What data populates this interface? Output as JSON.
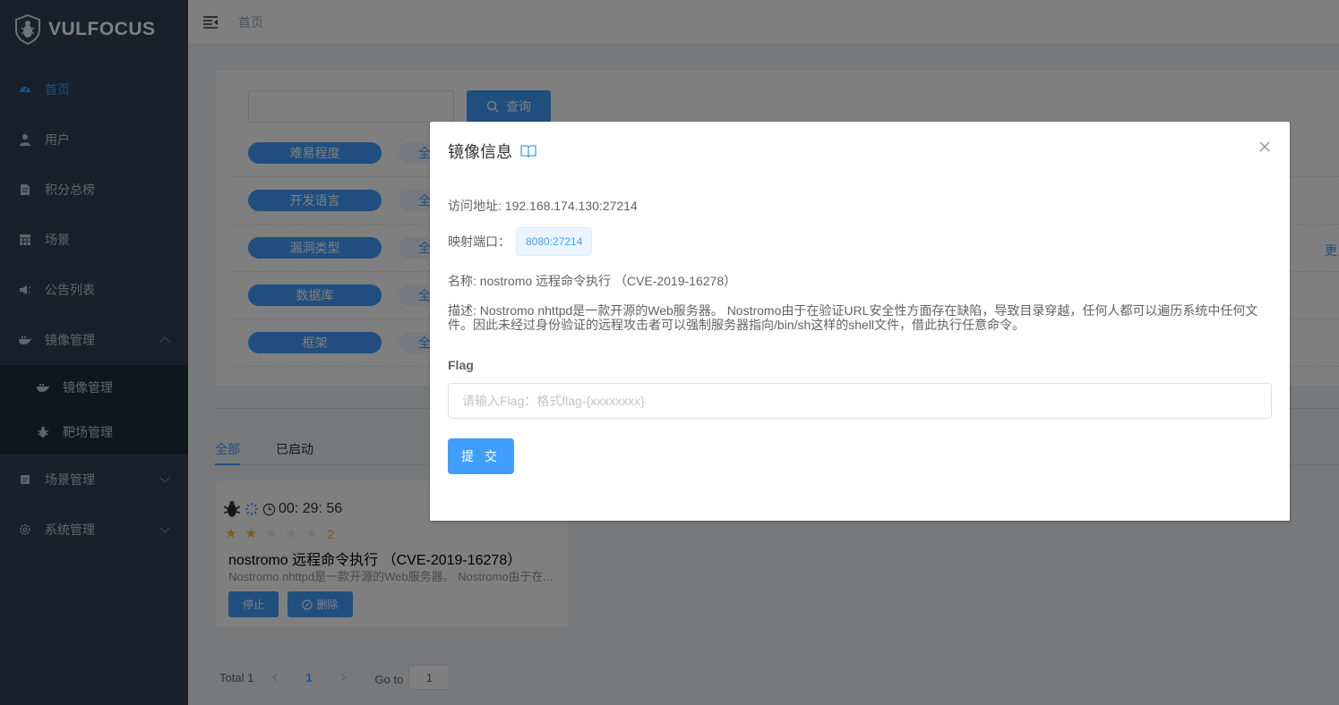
{
  "app": {
    "name": "VULFOCUS"
  },
  "sidebar": {
    "items": [
      {
        "label": "首页",
        "icon": "dashboard-icon",
        "active": true
      },
      {
        "label": "用户",
        "icon": "user-icon"
      },
      {
        "label": "积分总榜",
        "icon": "ranking-icon"
      },
      {
        "label": "场景",
        "icon": "table-icon"
      },
      {
        "label": "公告列表",
        "icon": "announcement-icon"
      },
      {
        "label": "镜像管理",
        "icon": "docker-icon",
        "expanded": true,
        "children": [
          {
            "label": "镜像管理",
            "icon": "docker-icon"
          },
          {
            "label": "靶场管理",
            "icon": "bug-icon"
          }
        ]
      },
      {
        "label": "场景管理",
        "icon": "scene-icon"
      },
      {
        "label": "系统管理",
        "icon": "gear-icon"
      }
    ]
  },
  "header": {
    "breadcrumb": "首页"
  },
  "search": {
    "placeholder": "",
    "button": "查询"
  },
  "filters": [
    {
      "label": "难易程度",
      "all": "全"
    },
    {
      "label": "开发语言",
      "all": "全"
    },
    {
      "label": "漏洞类型",
      "all": "全"
    },
    {
      "label": "数据库",
      "all": "全"
    },
    {
      "label": "框架",
      "all": "全"
    }
  ],
  "more_label": "更",
  "tabs": [
    {
      "label": "全部",
      "active": true
    },
    {
      "label": "已启动"
    }
  ],
  "vuln_card": {
    "timer": "00: 29: 56",
    "rating": 2,
    "rating_max": 5,
    "rating_text": "2",
    "title": "nostromo 远程命令执行 （CVE-2019-16278）",
    "desc": "Nostromo nhttpd是一款开源的Web服务器。 Nostromo由于在...",
    "stop_label": "停止",
    "delete_label": "删除"
  },
  "pagination": {
    "total": "Total 1",
    "current": "1",
    "goto_label": "Go to",
    "goto_value": "1"
  },
  "dialog": {
    "title": "镜像信息",
    "address": "访问地址: 192.168.174.130:27214",
    "port_label": "映射端口：",
    "port_value": "8080:27214",
    "name": "名称: nostromo 远程命令执行 （CVE-2019-16278）",
    "desc": "描述: Nostromo nhttpd是一款开源的Web服务器。 Nostromo由于在验证URL安全性方面存在缺陷，导致目录穿越，任何人都可以遍历系统中任何文件。因此未经过身份验证的远程攻击者可以强制服务器指向/bin/sh这样的shell文件，借此执行任意命令。",
    "flag_label": "Flag",
    "flag_placeholder": "请输入Flag：格式flag-{xxxxxxxx}",
    "flag_value": "",
    "submit_label": "提 交"
  },
  "colors": {
    "sidebar_bg": "#304156",
    "primary": "#409eff",
    "star": "#f7ba2a"
  }
}
